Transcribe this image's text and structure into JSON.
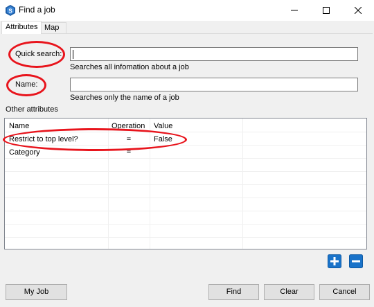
{
  "window": {
    "title": "Find a job",
    "icon": "app-logo-icon",
    "controls": [
      "minimize-icon",
      "maximize-icon",
      "close-icon"
    ]
  },
  "tabs": [
    {
      "label": "Attributes",
      "active": true
    },
    {
      "label": "Map",
      "active": false
    }
  ],
  "quick_search": {
    "label": "Quick search:",
    "value": "",
    "hint": "Searches all infomation about a job"
  },
  "name": {
    "label": "Name:",
    "value": "",
    "hint": "Searches only the name of a job"
  },
  "other_attributes": {
    "heading": "Other attributes",
    "columns": [
      "Name",
      "Operation",
      "Value"
    ],
    "rows": [
      {
        "name": "Restrict to top level?",
        "operation": "=",
        "value": "False"
      },
      {
        "name": "Category",
        "operation": "=",
        "value": ""
      }
    ]
  },
  "grid_actions": {
    "add_icon": "plus-icon",
    "remove_icon": "minus-icon",
    "accent": "#1a73c9"
  },
  "buttons": {
    "my_job": "My Job",
    "find": "Find",
    "clear": "Clear",
    "cancel": "Cancel"
  },
  "annotation_color": "#e8141c"
}
